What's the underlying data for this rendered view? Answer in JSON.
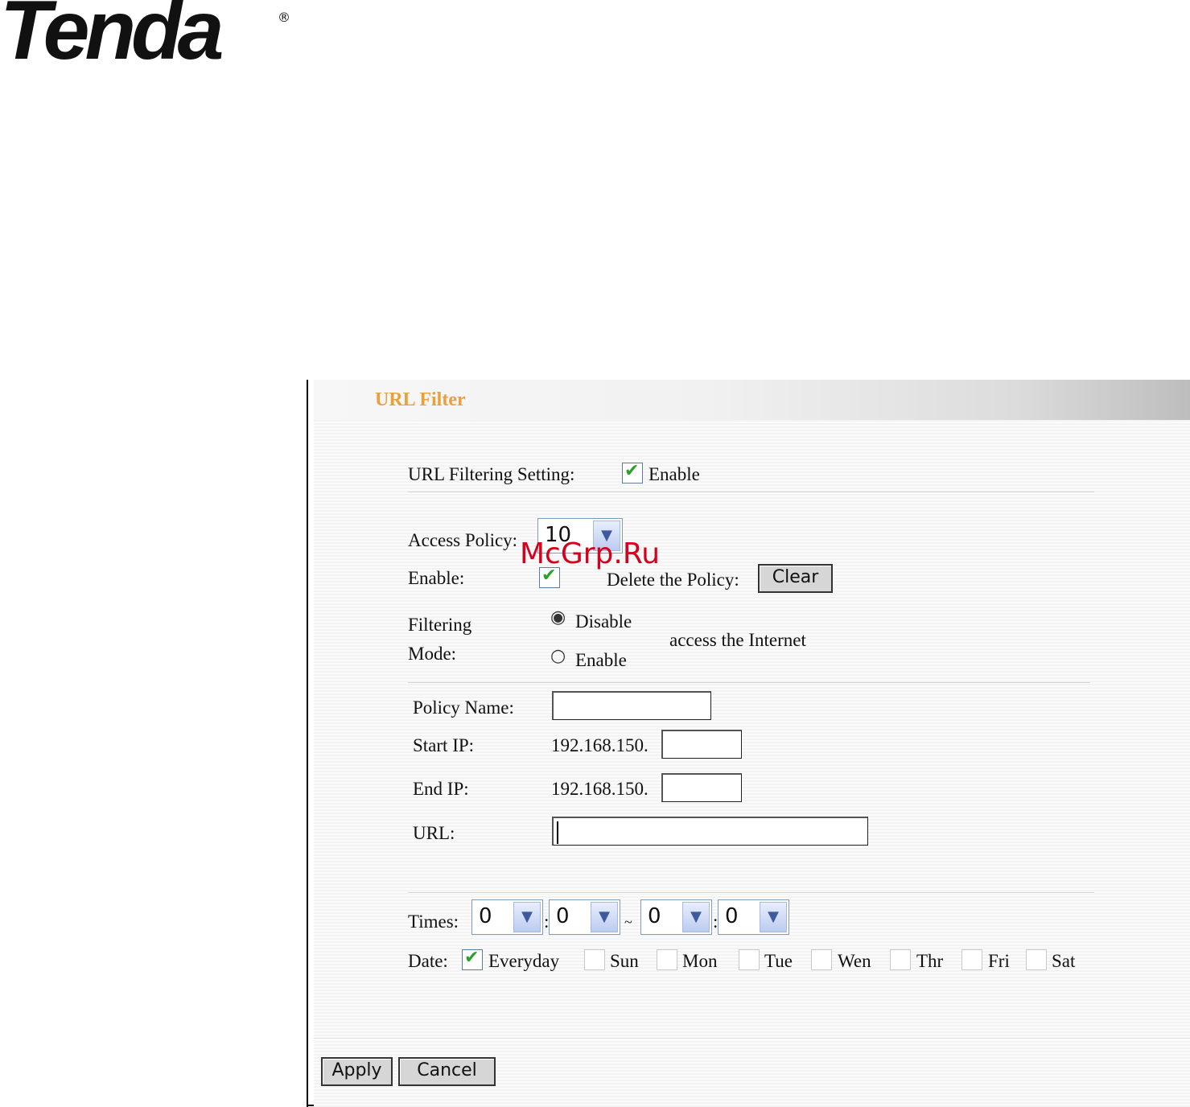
{
  "brand": {
    "logo_text": "Tenda",
    "reg_mark": "®"
  },
  "watermark": "McGrp.Ru",
  "panel": {
    "title": "URL Filter"
  },
  "url_filtering": {
    "label": "URL Filtering Setting:",
    "enable_label": "Enable",
    "enabled": true
  },
  "access_policy": {
    "label": "Access Policy:",
    "value": "10"
  },
  "policy_enable": {
    "label": "Enable:",
    "checked": true
  },
  "delete_policy": {
    "label": "Delete the Policy:",
    "button": "Clear"
  },
  "filtering_mode": {
    "label_line1": "Filtering",
    "label_line2": "Mode:",
    "option_disable": "Disable",
    "option_enable": "Enable",
    "selected": "Disable",
    "suffix": "access the Internet"
  },
  "policy_name": {
    "label": "Policy Name:",
    "value": ""
  },
  "start_ip": {
    "label": "Start IP:",
    "prefix": "192.168.150.",
    "value": ""
  },
  "end_ip": {
    "label": "End IP:",
    "prefix": "192.168.150.",
    "value": ""
  },
  "url": {
    "label": "URL:",
    "value": ""
  },
  "times": {
    "label": "Times:",
    "start_hour": "0",
    "start_min": "0",
    "end_hour": "0",
    "end_min": "0",
    "colon": ":",
    "tilde": "~"
  },
  "date": {
    "label": "Date:",
    "days": [
      {
        "label": "Everyday",
        "checked": true
      },
      {
        "label": "Sun",
        "checked": false
      },
      {
        "label": "Mon",
        "checked": false
      },
      {
        "label": "Tue",
        "checked": false
      },
      {
        "label": "Wen",
        "checked": false
      },
      {
        "label": "Thr",
        "checked": false
      },
      {
        "label": "Fri",
        "checked": false
      },
      {
        "label": "Sat",
        "checked": false
      }
    ]
  },
  "buttons": {
    "apply": "Apply",
    "cancel": "Cancel"
  },
  "icons": {
    "check": "✔",
    "arrow": "▼",
    "radio_on": "◉",
    "radio_off": "○"
  }
}
